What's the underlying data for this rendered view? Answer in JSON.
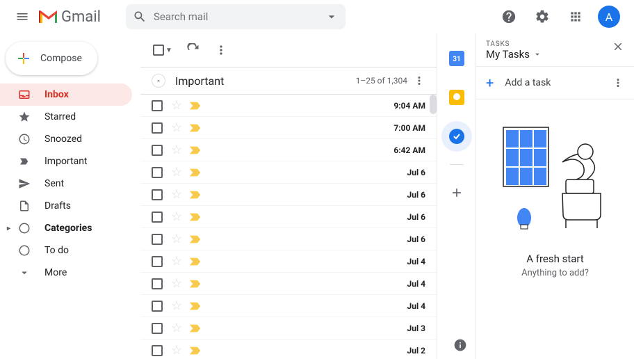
{
  "header": {
    "logo_text": "Gmail",
    "search_placeholder": "Search mail",
    "avatar_initial": "A"
  },
  "compose_label": "Compose",
  "nav": [
    {
      "icon": "inbox",
      "label": "Inbox",
      "active": true,
      "bold": true
    },
    {
      "icon": "star",
      "label": "Starred"
    },
    {
      "icon": "clock",
      "label": "Snoozed"
    },
    {
      "icon": "important",
      "label": "Important"
    },
    {
      "icon": "sent",
      "label": "Sent"
    },
    {
      "icon": "drafts",
      "label": "Drafts"
    },
    {
      "icon": "categories",
      "label": "Categories",
      "bold": true,
      "caret": true
    },
    {
      "icon": "todo",
      "label": "To do"
    },
    {
      "icon": "more",
      "label": "More"
    }
  ],
  "section": {
    "title": "Important",
    "count": "1–25 of 1,304"
  },
  "mails": [
    {
      "date": "9:04 AM"
    },
    {
      "date": "7:00 AM"
    },
    {
      "date": "6:42 AM"
    },
    {
      "date": "Jul 6"
    },
    {
      "date": "Jul 6"
    },
    {
      "date": "Jul 6"
    },
    {
      "date": "Jul 6"
    },
    {
      "date": "Jul 4"
    },
    {
      "date": "Jul 4"
    },
    {
      "date": "Jul 4"
    },
    {
      "date": "Jul 3"
    },
    {
      "date": "Jul 2"
    }
  ],
  "rail": [
    {
      "name": "calendar",
      "fill": "#4285f4",
      "label": "31",
      "active": false
    },
    {
      "name": "keep",
      "fill": "#fbbc04",
      "active": false
    },
    {
      "name": "tasks",
      "fill": "#1a73e8",
      "active": true
    }
  ],
  "tasks": {
    "label": "Tasks",
    "title": "My Tasks",
    "add_label": "Add a task",
    "empty_title": "A fresh start",
    "empty_sub": "Anything to add?"
  }
}
